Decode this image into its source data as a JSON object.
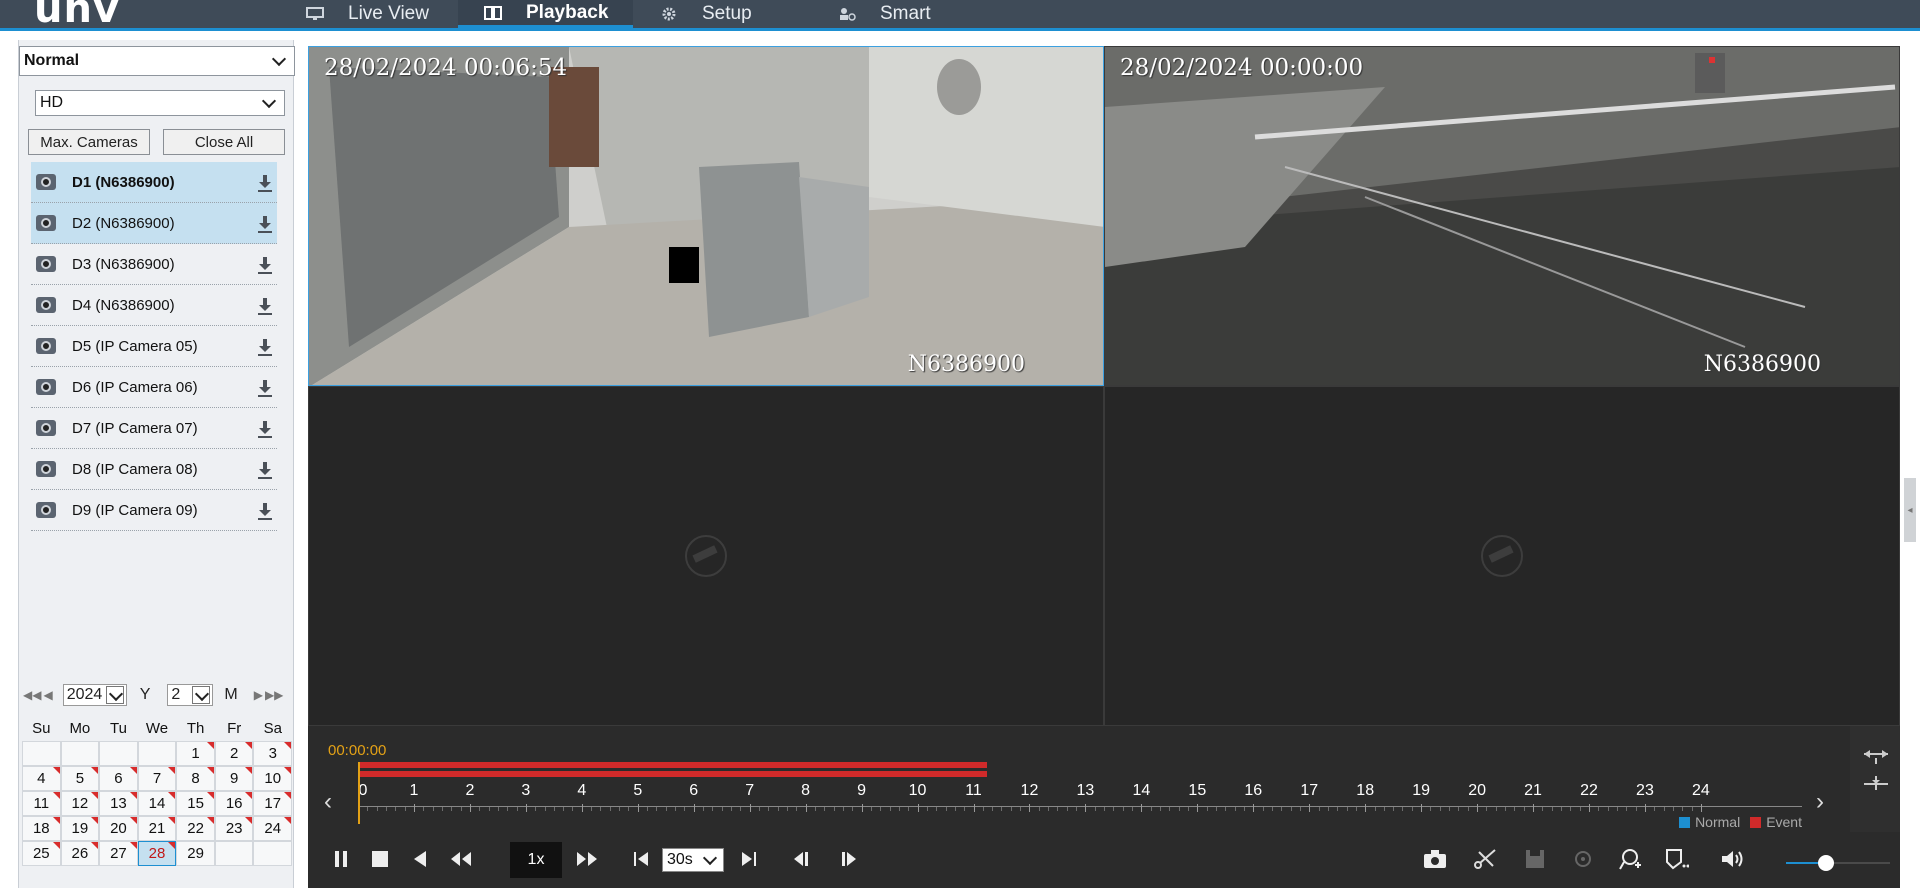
{
  "brand": {
    "logo": "unv"
  },
  "nav": {
    "tabs": [
      {
        "label": "Live View",
        "active": false,
        "icon": "monitor-icon"
      },
      {
        "label": "Playback",
        "active": true,
        "icon": "book-icon"
      },
      {
        "label": "Setup",
        "active": false,
        "icon": "gear-icon"
      },
      {
        "label": "Smart",
        "active": false,
        "icon": "person-gear-icon"
      }
    ]
  },
  "left": {
    "record_type": "Normal",
    "stream": "HD",
    "max_cameras_label": "Max. Cameras",
    "close_all_label": "Close All",
    "cameras": [
      {
        "label": "D1 (N6386900)",
        "selected": true,
        "bold": true
      },
      {
        "label": "D2 (N6386900)",
        "selected": true,
        "bold": false
      },
      {
        "label": "D3 (N6386900)",
        "selected": false,
        "bold": false
      },
      {
        "label": "D4 (N6386900)",
        "selected": false,
        "bold": false
      },
      {
        "label": "D5 (IP Camera 05)",
        "selected": false,
        "bold": false
      },
      {
        "label": "D6 (IP Camera 06)",
        "selected": false,
        "bold": false
      },
      {
        "label": "D7 (IP Camera 07)",
        "selected": false,
        "bold": false
      },
      {
        "label": "D8 (IP Camera 08)",
        "selected": false,
        "bold": false
      },
      {
        "label": "D9 (IP Camera 09)",
        "selected": false,
        "bold": false
      }
    ]
  },
  "calendar": {
    "year": "2024",
    "year_suffix": "Y",
    "month": "2",
    "month_suffix": "M",
    "weekdays": [
      "Su",
      "Mo",
      "Tu",
      "We",
      "Th",
      "Fr",
      "Sa"
    ],
    "weeks": [
      [
        "",
        "",
        "",
        "",
        "1",
        "2",
        "3"
      ],
      [
        "4",
        "5",
        "6",
        "7",
        "8",
        "9",
        "10"
      ],
      [
        "11",
        "12",
        "13",
        "14",
        "15",
        "16",
        "17"
      ],
      [
        "18",
        "19",
        "20",
        "21",
        "22",
        "23",
        "24"
      ],
      [
        "25",
        "26",
        "27",
        "28",
        "29",
        "",
        ""
      ]
    ],
    "recorded_days": [
      "1",
      "2",
      "3",
      "4",
      "5",
      "6",
      "7",
      "8",
      "9",
      "10",
      "11",
      "12",
      "13",
      "14",
      "15",
      "16",
      "17",
      "18",
      "19",
      "20",
      "21",
      "22",
      "23",
      "24",
      "25",
      "26",
      "27",
      "28"
    ],
    "selected_day": "28"
  },
  "video": {
    "tiles": [
      {
        "timestamp": "28/02/2024 00:06:54",
        "camera": "N6386900",
        "active": true,
        "signal": true
      },
      {
        "timestamp": "28/02/2024 00:00:00",
        "camera": "N6386900",
        "active": false,
        "signal": true
      },
      {
        "timestamp": "",
        "camera": "",
        "active": false,
        "signal": false
      },
      {
        "timestamp": "",
        "camera": "",
        "active": false,
        "signal": false
      }
    ]
  },
  "timeline": {
    "cursor_time": "00:00:00",
    "hours": [
      "0",
      "1",
      "2",
      "3",
      "4",
      "5",
      "6",
      "7",
      "8",
      "9",
      "10",
      "11",
      "12",
      "13",
      "14",
      "15",
      "16",
      "17",
      "18",
      "19",
      "20",
      "21",
      "22",
      "23",
      "24"
    ],
    "recorded_until_hour": 11.2,
    "legend": {
      "normal_label": "Normal",
      "event_label": "Event",
      "normal_color": "#1d8fd1",
      "event_color": "#d02a2a"
    }
  },
  "controls": {
    "speed": "1x",
    "interval": "30s",
    "volume_fraction": 0.38
  },
  "colors": {
    "accent": "#1d8fd1",
    "record": "#d02a2a",
    "cursor": "#e3a116"
  }
}
